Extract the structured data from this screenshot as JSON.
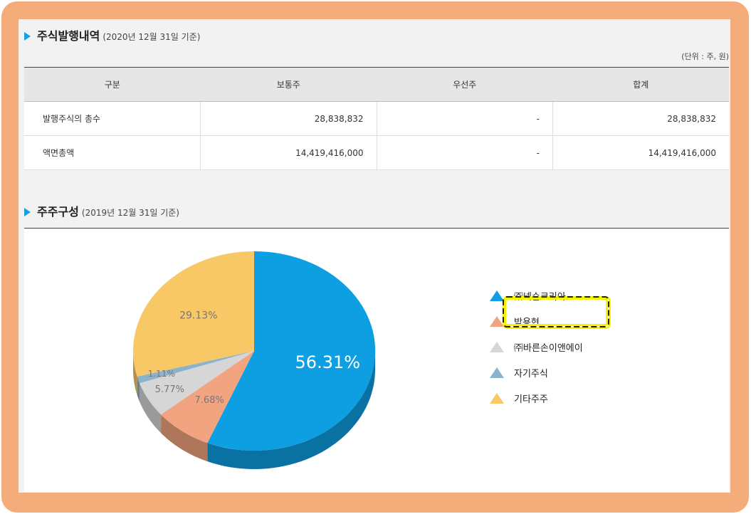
{
  "section1": {
    "title": "주식발행내역",
    "date": "(2020년 12월 31일 기준)",
    "unit": "(단위 : 주, 원)",
    "headers": [
      "구분",
      "보통주",
      "우선주",
      "합계"
    ],
    "rows": [
      [
        "발행주식의 총수",
        "28,838,832",
        "-",
        "28,838,832"
      ],
      [
        "액면총액",
        "14,419,416,000",
        "-",
        "14,419,416,000"
      ]
    ]
  },
  "section2": {
    "title": "주주구성",
    "date": "(2019년 12월 31일 기준)"
  },
  "chart_data": {
    "type": "pie",
    "categories": [
      "㈜넥슨코리아",
      "박용현",
      "㈜바른손이앤에이",
      "자기주식",
      "기타주주"
    ],
    "values": [
      56.31,
      7.68,
      5.77,
      1.11,
      29.13
    ],
    "labels": [
      "56.31%",
      "7.68%",
      "5.77%",
      "1.11%",
      "29.13%"
    ],
    "colors": [
      "#0e9fe2",
      "#f1a47f",
      "#d6d6d6",
      "#8bb3cc",
      "#f8c766"
    ],
    "legend_position": "right",
    "highlighted": "㈜넥슨코리아"
  }
}
